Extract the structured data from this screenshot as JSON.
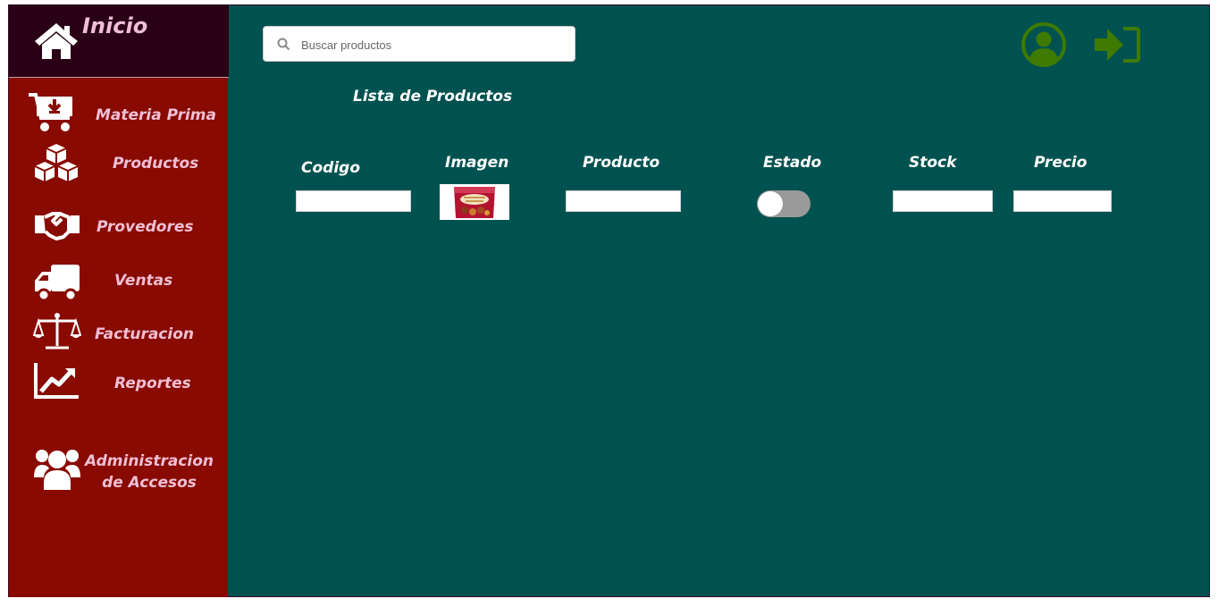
{
  "sidebar": {
    "home": {
      "label": "Inicio",
      "icon": "home-icon"
    },
    "items": [
      {
        "label": "Materia Prima",
        "icon": "cart-download-icon"
      },
      {
        "label": "Productos",
        "icon": "cubes-icon"
      },
      {
        "label": "Provedores",
        "icon": "handshake-icon"
      },
      {
        "label": "Ventas",
        "icon": "truck-icon"
      },
      {
        "label": "Facturacion",
        "icon": "balance-scale-icon"
      },
      {
        "label": "Reportes",
        "icon": "chart-line-icon"
      },
      {
        "label_line1": "Administracion",
        "label_line2": "de Accesos",
        "icon": "users-icon"
      }
    ]
  },
  "search": {
    "placeholder": "Buscar productos",
    "value": ""
  },
  "header": {
    "user_icon": "user-circle-icon",
    "logout_icon": "sign-in-icon"
  },
  "main": {
    "title": "Lista de Productos",
    "columns": [
      "Codigo",
      "Imagen",
      "Producto",
      "Estado",
      "Stock",
      "Precio"
    ],
    "row": {
      "codigo": "",
      "producto": "",
      "estado_on": false,
      "stock": "",
      "precio": ""
    }
  },
  "colors": {
    "sidebar_bg": "#880a00",
    "sidebar_header_bg": "#2a0016",
    "main_bg": "#005250",
    "nav_text": "#f1bfd5",
    "header_icon": "#3e7a00"
  }
}
